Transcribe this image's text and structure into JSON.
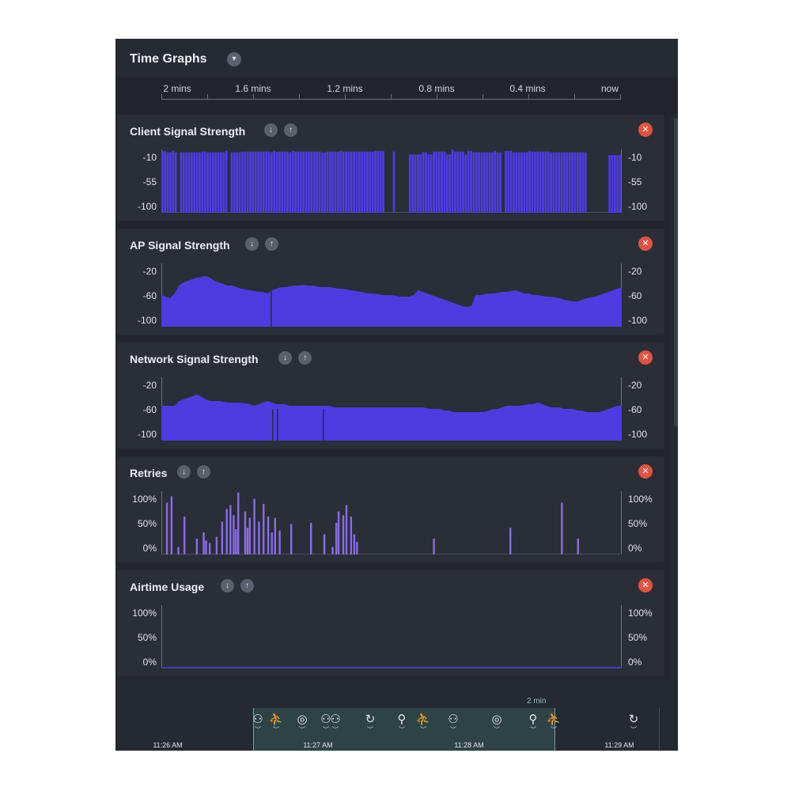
{
  "header": {
    "title": "Time Graphs"
  },
  "time_axis": {
    "labels": [
      "2 mins",
      "1.6 mins",
      "1.2 mins",
      "0.8 mins",
      "0.4 mins",
      "now"
    ]
  },
  "colors": {
    "bar": "#4f3be0",
    "retry": "#8c6be6",
    "close": "#e2533f",
    "selection": "#2e4344"
  },
  "icons": {
    "sort_down": "arrow-down-icon",
    "sort_up": "arrow-up-icon",
    "close": "close-icon"
  },
  "panels": [
    {
      "title": "Client Signal Strength",
      "ticks": [
        "-10",
        "-55",
        "-100"
      ]
    },
    {
      "title": "AP Signal Strength",
      "ticks": [
        "-20",
        "-60",
        "-100"
      ]
    },
    {
      "title": "Network Signal Strength",
      "ticks": [
        "-20",
        "-60",
        "-100"
      ]
    },
    {
      "title": "Retries",
      "ticks": [
        "100%",
        "50%",
        "0%"
      ]
    },
    {
      "title": "Airtime Usage",
      "ticks": [
        "100%",
        "50%",
        "0%"
      ]
    }
  ],
  "chart_data": [
    {
      "type": "bar",
      "title": "Client Signal Strength",
      "x_range": [
        "2 mins",
        "now"
      ],
      "ylim": [
        -100,
        -10
      ],
      "yticks": [
        -10,
        -55,
        -100
      ],
      "values": [
        -12,
        -12,
        -14,
        -14,
        -12,
        -14,
        null,
        -14,
        -14,
        -14,
        -14,
        -14,
        -14,
        -14,
        -14,
        -13,
        -13,
        -14,
        -14,
        -14,
        -14,
        -14,
        -14,
        -14,
        -12,
        null,
        -14,
        -14,
        -14,
        -14,
        -13,
        -13,
        -13,
        -13,
        -13,
        -13,
        -13,
        -13,
        -13,
        -13,
        -13,
        -14,
        -12,
        -13,
        -13,
        -13,
        -13,
        -13,
        -14,
        -12,
        -13,
        -13,
        -13,
        -13,
        -13,
        -13,
        -13,
        -13,
        -13,
        -13,
        -14,
        -14,
        -13,
        -13,
        -13,
        -13,
        -13,
        -12,
        -13,
        -13,
        -13,
        -13,
        -13,
        -13,
        -13,
        -13,
        -13,
        -13,
        -13,
        -13,
        -12,
        -12,
        -12,
        -12,
        null,
        null,
        null,
        -13,
        null,
        null,
        null,
        null,
        null,
        -17,
        -17,
        -17,
        -17,
        -17,
        -14,
        -14,
        -17,
        -17,
        -13,
        -13,
        -13,
        -13,
        -13,
        -17,
        -17,
        -10,
        -13,
        -13,
        -13,
        -13,
        -17,
        -12,
        -12,
        -14,
        -14,
        -14,
        -14,
        -14,
        -14,
        -14,
        -14,
        -12,
        -14,
        -14,
        null,
        -12,
        -12,
        -12,
        -14,
        -14,
        -14,
        -14,
        -14,
        -14,
        -12,
        -13,
        -13,
        -13,
        -13,
        -13,
        -13,
        -13,
        -14,
        -14,
        -14,
        -14,
        -14,
        -14,
        -14,
        -14,
        -14,
        -14,
        -14,
        -14,
        -14,
        -14,
        null,
        null,
        null,
        null,
        null,
        null,
        null,
        null,
        -18,
        -18,
        -18,
        -18,
        -18
      ]
    },
    {
      "type": "area",
      "title": "AP Signal Strength",
      "x_range": [
        "2 mins",
        "now"
      ],
      "ylim": [
        -100,
        -20
      ],
      "yticks": [
        -20,
        -60,
        -100
      ],
      "values": [
        -60,
        -62,
        -64,
        -58,
        -48,
        -44,
        -42,
        -40,
        -38,
        -37,
        -36,
        -38,
        -42,
        -44,
        -46,
        -48,
        -48,
        -50,
        -52,
        -53,
        -54,
        -55,
        -56,
        -56,
        -58,
        -54,
        -52,
        -50,
        -50,
        -49,
        -48,
        -48,
        -47,
        -48,
        -48,
        -49,
        -50,
        -50,
        -50,
        -51,
        -52,
        -52,
        -53,
        -54,
        -55,
        -56,
        -57,
        -58,
        -58,
        -59,
        -60,
        -60,
        -60,
        -61,
        -62,
        -62,
        -62,
        -60,
        -54,
        -56,
        -58,
        -60,
        -62,
        -64,
        -66,
        -68,
        -70,
        -72,
        -74,
        -75,
        -74,
        -60,
        -60,
        -59,
        -58,
        -58,
        -57,
        -56,
        -56,
        -55,
        -54,
        -56,
        -58,
        -58,
        -60,
        -60,
        -61,
        -62,
        -62,
        -63,
        -64,
        -66,
        -67,
        -68,
        -68,
        -66,
        -64,
        -63,
        -62,
        -60,
        -58,
        -56,
        -54,
        -52,
        -50
      ]
    },
    {
      "type": "area",
      "title": "Network Signal Strength",
      "x_range": [
        "2 mins",
        "now"
      ],
      "ylim": [
        -100,
        -20
      ],
      "yticks": [
        -20,
        -60,
        -100
      ],
      "values": [
        -56,
        -56,
        -56,
        -56,
        -50,
        -48,
        -46,
        -44,
        -42,
        -44,
        -48,
        -50,
        -50,
        -50,
        -51,
        -52,
        -52,
        -52,
        -52,
        -53,
        -54,
        -56,
        -54,
        -52,
        -50,
        -52,
        -54,
        -54,
        -54,
        -56,
        -56,
        -56,
        -56,
        -56,
        -56,
        -56,
        -56,
        -56,
        -56,
        -58,
        -58,
        -58,
        -58,
        -58,
        -58,
        -58,
        -58,
        -58,
        -58,
        -58,
        -58,
        -58,
        -58,
        -58,
        -58,
        -58,
        -58,
        -58,
        -58,
        -58,
        -59,
        -60,
        -60,
        -60,
        -62,
        -62,
        -64,
        -64,
        -64,
        -64,
        -64,
        -64,
        -64,
        -64,
        -62,
        -60,
        -60,
        -58,
        -56,
        -56,
        -56,
        -56,
        -55,
        -54,
        -54,
        -52,
        -54,
        -56,
        -58,
        -58,
        -58,
        -60,
        -60,
        -60,
        -62,
        -62,
        -64,
        -64,
        -64,
        -64,
        -62,
        -60,
        -58,
        -56,
        -56
      ]
    },
    {
      "type": "bar",
      "title": "Retries",
      "x_range": [
        "2 mins",
        "now"
      ],
      "ylim": [
        0,
        100
      ],
      "yticks": [
        "0%",
        "50%",
        "100%"
      ],
      "points": [
        [
          0.01,
          82
        ],
        [
          0.02,
          92
        ],
        [
          0.035,
          12
        ],
        [
          0.048,
          60
        ],
        [
          0.075,
          25
        ],
        [
          0.09,
          35
        ],
        [
          0.095,
          22
        ],
        [
          0.103,
          18
        ],
        [
          0.118,
          28
        ],
        [
          0.13,
          52
        ],
        [
          0.14,
          72
        ],
        [
          0.148,
          78
        ],
        [
          0.155,
          62
        ],
        [
          0.16,
          40
        ],
        [
          0.165,
          98
        ],
        [
          0.18,
          68
        ],
        [
          0.185,
          42
        ],
        [
          0.19,
          58
        ],
        [
          0.2,
          88
        ],
        [
          0.21,
          52
        ],
        [
          0.22,
          80
        ],
        [
          0.23,
          60
        ],
        [
          0.238,
          35
        ],
        [
          0.245,
          58
        ],
        [
          0.255,
          38
        ],
        [
          0.28,
          48
        ],
        [
          0.323,
          50
        ],
        [
          0.352,
          32
        ],
        [
          0.37,
          12
        ],
        [
          0.378,
          50
        ],
        [
          0.383,
          68
        ],
        [
          0.393,
          62
        ],
        [
          0.4,
          78
        ],
        [
          0.41,
          60
        ],
        [
          0.417,
          32
        ],
        [
          0.423,
          20
        ],
        [
          0.59,
          25
        ],
        [
          0.756,
          42
        ],
        [
          0.868,
          82
        ],
        [
          0.903,
          25
        ]
      ]
    },
    {
      "type": "area",
      "title": "Airtime Usage",
      "x_range": [
        "2 mins",
        "now"
      ],
      "ylim": [
        0,
        100
      ],
      "yticks": [
        "0%",
        "50%",
        "100%"
      ],
      "values": [
        2,
        2,
        2,
        2,
        2,
        2,
        2,
        2,
        2,
        2,
        2,
        2,
        2,
        2,
        2,
        2,
        2,
        2,
        2,
        2
      ]
    }
  ],
  "timeline": {
    "selection_label": "2 min",
    "time_labels": [
      "11:26 AM",
      "11:27 AM",
      "11:28 AM",
      "11:29 AM"
    ],
    "events": [
      {
        "icon": "roam-icon",
        "glyph": "⚇"
      },
      {
        "icon": "running-icon",
        "glyph": "⛹"
      },
      {
        "icon": "signal-icon",
        "glyph": "◎"
      },
      {
        "icon": "group-icon",
        "glyph": "⚇"
      },
      {
        "icon": "refresh-icon",
        "glyph": "↻"
      },
      {
        "icon": "zoom-icon",
        "glyph": "⚲"
      },
      {
        "icon": "running-icon",
        "glyph": "⛹"
      },
      {
        "icon": "roam-icon",
        "glyph": "⚇"
      },
      {
        "icon": "signal-icon",
        "glyph": "◎"
      },
      {
        "icon": "zoom-icon",
        "glyph": "⚲"
      },
      {
        "icon": "running-icon",
        "glyph": "⛹"
      },
      {
        "icon": "refresh-icon",
        "glyph": "↻"
      }
    ]
  }
}
